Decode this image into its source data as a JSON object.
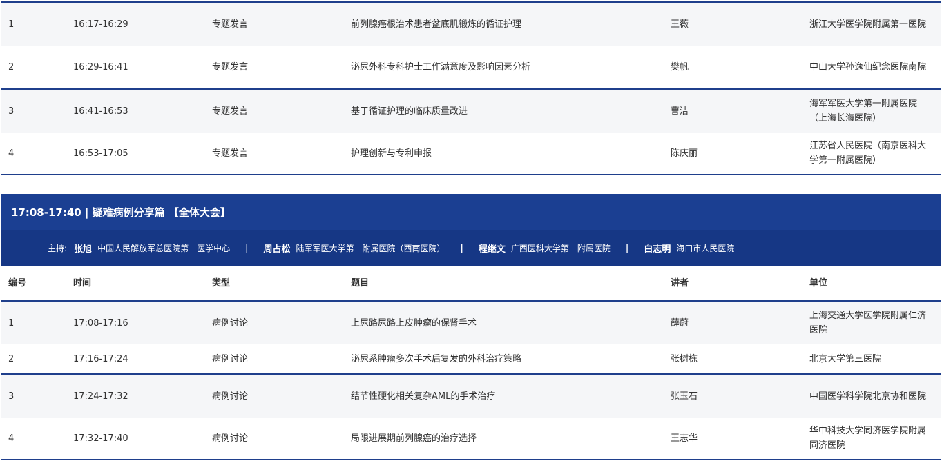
{
  "table1": {
    "rows": [
      {
        "no": "1",
        "time": "16:17-16:29",
        "type": "专题发言",
        "topic": "前列腺癌根治术患者盆底肌锻炼的循证护理",
        "speaker": "王薇",
        "unit": "浙江大学医学院附属第一医院"
      },
      {
        "no": "2",
        "time": "16:29-16:41",
        "type": "专题发言",
        "topic": "泌尿外科专科护士工作满意度及影响因素分析",
        "speaker": "樊帆",
        "unit": "中山大学孙逸仙纪念医院南院"
      },
      {
        "no": "3",
        "time": "16:41-16:53",
        "type": "专题发言",
        "topic": "基于循证护理的临床质量改进",
        "speaker": "曹洁",
        "unit": "海军军医大学第一附属医院（上海长海医院）"
      },
      {
        "no": "4",
        "time": "16:53-17:05",
        "type": "专题发言",
        "topic": "护理创新与专利申报",
        "speaker": "陈庆丽",
        "unit": "江苏省人民医院（南京医科大学第一附属医院）"
      }
    ]
  },
  "session": {
    "title": "17:08-17:40 | 疑难病例分享篇 【全体大会】",
    "host_label": "主持:",
    "separator": "|",
    "hosts": [
      {
        "name": "张旭",
        "org": "中国人民解放军总医院第一医学中心"
      },
      {
        "name": "周占松",
        "org": "陆军军医大学第一附属医院（西南医院）"
      },
      {
        "name": "程继文",
        "org": "广西医科大学第一附属医院"
      },
      {
        "name": "白志明",
        "org": "海口市人民医院"
      }
    ]
  },
  "table2": {
    "headers": {
      "no": "编号",
      "time": "时间",
      "type": "类型",
      "topic": "题目",
      "speaker": "讲者",
      "unit": "单位"
    },
    "rows": [
      {
        "no": "1",
        "time": "17:08-17:16",
        "type": "病例讨论",
        "topic": "上尿路尿路上皮肿瘤的保肾手术",
        "speaker": "薛蔚",
        "unit": "上海交通大学医学院附属仁济医院"
      },
      {
        "no": "2",
        "time": "17:16-17:24",
        "type": "病例讨论",
        "topic": "泌尿系肿瘤多次手术后复发的外科治疗策略",
        "speaker": "张树栋",
        "unit": "北京大学第三医院"
      },
      {
        "no": "3",
        "time": "17:24-17:32",
        "type": "病例讨论",
        "topic": "结节性硬化相关复杂AML的手术治疗",
        "speaker": "张玉石",
        "unit": "中国医学科学院北京协和医院"
      },
      {
        "no": "4",
        "time": "17:32-17:40",
        "type": "病例讨论",
        "topic": "局限进展期前列腺癌的治疗选择",
        "speaker": "王志华",
        "unit": "华中科技大学同济医学院附属同济医院"
      }
    ]
  },
  "colors": {
    "accent": "#1b3f92",
    "accent_dark": "#163785",
    "row_alt": "#f5f6f8"
  }
}
